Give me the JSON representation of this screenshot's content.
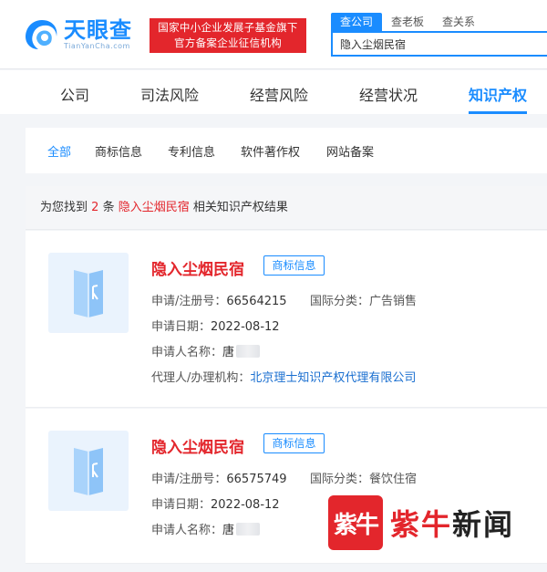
{
  "header": {
    "logo_cn": "天眼查",
    "logo_en": "TianYanCha.com",
    "banner_line1": "国家中小企业发展子基金旗下",
    "banner_line2": "官方备案企业征信机构",
    "search_tabs": [
      "查公司",
      "查老板",
      "查关系"
    ],
    "search_value": "隐入尘烟民宿"
  },
  "nav": {
    "items": [
      "公司",
      "司法风险",
      "经营风险",
      "经营状况",
      "知识产权"
    ],
    "active": "知识产权"
  },
  "subnav": {
    "items": [
      "全部",
      "商标信息",
      "专利信息",
      "软件著作权",
      "网站备案"
    ]
  },
  "result_count": {
    "prefix": "为您找到",
    "count": "2",
    "unit": "条",
    "keyword": "隐入尘烟民宿",
    "suffix": "相关知识产权结果"
  },
  "results": [
    {
      "title": "隐入尘烟民宿",
      "tag": "商标信息",
      "reg_label": "申请/注册号：",
      "reg_no": "66564215",
      "class_label": "国际分类：",
      "class_value": "广告销售",
      "date_label": "申请日期：",
      "date": "2022-08-12",
      "applicant_label": "申请人名称：",
      "applicant": "唐",
      "agent_label": "代理人/办理机构：",
      "agent": "北京理士知识产权代理有限公司"
    },
    {
      "title": "隐入尘烟民宿",
      "tag": "商标信息",
      "reg_label": "申请/注册号：",
      "reg_no": "66575749",
      "class_label": "国际分类：",
      "class_value": "餐饮住宿",
      "date_label": "申请日期：",
      "date": "2022-08-12",
      "applicant_label": "申请人名称：",
      "applicant": "唐"
    }
  ],
  "watermark": {
    "badge": "紫牛",
    "text_red": "紫牛",
    "text_black": "新闻"
  },
  "colors": {
    "accent": "#1a8cff",
    "brand_red": "#e3262c"
  }
}
